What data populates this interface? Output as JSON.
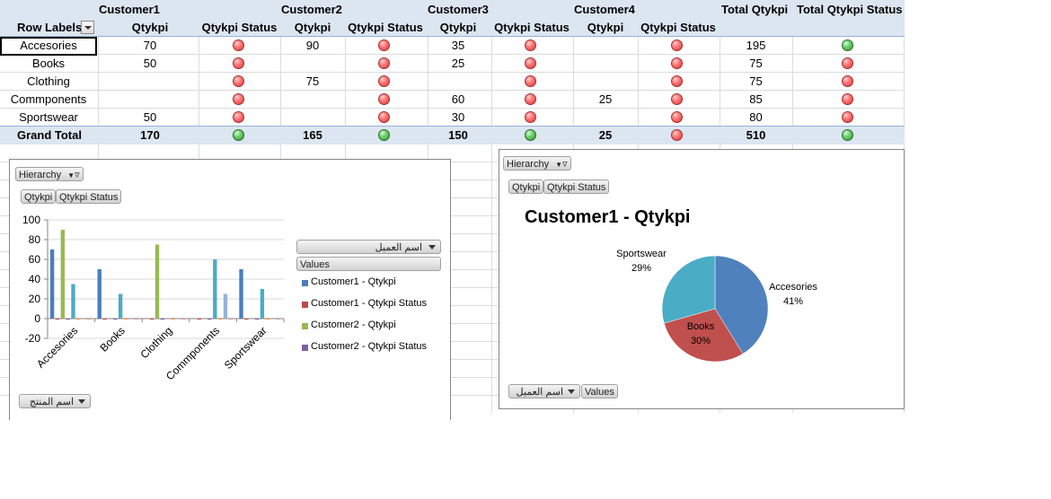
{
  "pivot": {
    "customers": [
      "Customer1",
      "Customer2",
      "Customer3",
      "Customer4"
    ],
    "total_qty_header": "Total Qtykpi",
    "total_status_header": "Total Qtykpi Status",
    "row_labels_header": "Row Labels",
    "qty_header": "Qtykpi",
    "status_header": "Qtykpi Status",
    "rows": [
      {
        "label": "Accesories",
        "qty": [
          "70",
          "90",
          "35",
          ""
        ],
        "status": [
          "red",
          "red",
          "red",
          "red"
        ],
        "total": "195",
        "total_status": "green"
      },
      {
        "label": "Books",
        "qty": [
          "50",
          "",
          "25",
          ""
        ],
        "status": [
          "red",
          "red",
          "red",
          "red"
        ],
        "total": "75",
        "total_status": "red"
      },
      {
        "label": "Clothing",
        "qty": [
          "",
          "75",
          "",
          ""
        ],
        "status": [
          "red",
          "red",
          "red",
          "red"
        ],
        "total": "75",
        "total_status": "red"
      },
      {
        "label": "Commponents",
        "qty": [
          "",
          "",
          "60",
          "25"
        ],
        "status": [
          "red",
          "red",
          "red",
          "red"
        ],
        "total": "85",
        "total_status": "red"
      },
      {
        "label": "Sportswear",
        "qty": [
          "50",
          "",
          "30",
          ""
        ],
        "status": [
          "red",
          "red",
          "red",
          "red"
        ],
        "total": "80",
        "total_status": "red"
      }
    ],
    "grand_total": {
      "label": "Grand Total",
      "qty": [
        "170",
        "165",
        "150",
        "25"
      ],
      "status": [
        "green",
        "green",
        "green",
        "red"
      ],
      "total": "510",
      "total_status": "green"
    }
  },
  "colors": {
    "series_blue": "#4a7ebb",
    "series_red": "#be4b48",
    "series_green": "#98b954",
    "series_purple": "#7d60a0",
    "teal": "#4bacc6",
    "light_blue": "#93b3d7",
    "header_band": "#dce6f1",
    "status_red": "#e03030",
    "status_green": "#2f962f"
  },
  "bar_panel": {
    "hierarchy_label": "Hierarchy",
    "value_buttons": [
      "Qtykpi",
      "Qtykpi Status"
    ],
    "legend_field": "اسم العميل",
    "legend_values": "Values",
    "axis_field": "اسم المنتج"
  },
  "pie_panel": {
    "hierarchy_label": "Hierarchy",
    "value_buttons": [
      "Qtykpi",
      "Qtykpi Status"
    ],
    "bottom_field": "اسم العميل",
    "bottom_values": "Values"
  },
  "chart_data": [
    {
      "type": "bar",
      "categories": [
        "Accesories",
        "Books",
        "Clothing",
        "Commponents",
        "Sportswear"
      ],
      "ylim": [
        -20,
        100
      ],
      "yticks": [
        "100",
        "80",
        "60",
        "40",
        "20",
        "0",
        "-20"
      ],
      "grid": true,
      "legend_position": "right",
      "series": [
        {
          "name": "Customer1 - Qtykpi",
          "color": "#4a7ebb",
          "values": [
            70,
            50,
            0,
            0,
            50
          ]
        },
        {
          "name": "Customer1 - Qtykpi Status",
          "color": "#be4b48",
          "values": [
            -1,
            -1,
            -1,
            -1,
            -1
          ]
        },
        {
          "name": "Customer2 - Qtykpi",
          "color": "#98b954",
          "values": [
            90,
            0,
            75,
            0,
            0
          ]
        },
        {
          "name": "Customer2 - Qtykpi Status",
          "color": "#7d60a0",
          "values": [
            -1,
            -1,
            -1,
            -1,
            -1
          ]
        },
        {
          "name": "",
          "color": "#4bacc6",
          "values": [
            35,
            25,
            0,
            60,
            30
          ]
        },
        {
          "name": "",
          "color": "#f79646",
          "values": [
            -1,
            -1,
            -1,
            -1,
            -1
          ]
        },
        {
          "name": "",
          "color": "#93b3d7",
          "values": [
            0,
            0,
            0,
            25,
            0
          ]
        },
        {
          "name": "",
          "color": "#d99694",
          "values": [
            -1,
            -1,
            -1,
            -1,
            -1
          ]
        }
      ]
    },
    {
      "type": "pie",
      "title": "Customer1 - Qtykpi",
      "slices": [
        {
          "label": "Accesories",
          "pct": "41%",
          "value": 70,
          "color": "#4f81bd"
        },
        {
          "label": "Books",
          "pct": "30%",
          "value": 50,
          "color": "#c0504d"
        },
        {
          "label": "Sportswear",
          "pct": "29%",
          "value": 50,
          "color": "#4bacc6"
        }
      ]
    }
  ]
}
